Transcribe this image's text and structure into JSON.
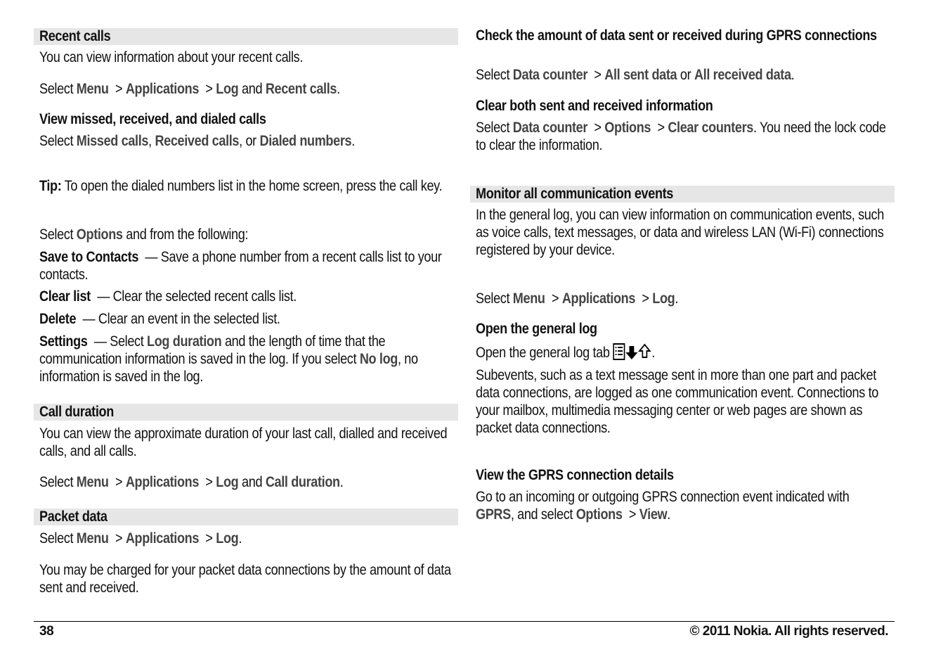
{
  "left": {
    "recent_calls": {
      "heading": "Recent calls",
      "intro": "You can view information about your recent calls.",
      "select_prefix": "Select ",
      "path": [
        "Menu",
        "Applications",
        "Log"
      ],
      "and": " and ",
      "target": "Recent calls",
      "period": "."
    },
    "view_missed": {
      "heading": "View missed, received, and dialed calls",
      "select_prefix": "Select ",
      "opt1": "Missed calls",
      "comma1": ", ",
      "opt2": "Received calls",
      "or": ", or ",
      "opt3": "Dialed numbers",
      "period": "."
    },
    "tip": {
      "label": "Tip:",
      "text": " To open the dialed numbers list in the home screen, press the call key."
    },
    "options": {
      "select_prefix": "Select ",
      "options_label": "Options",
      "suffix": " and from the following:",
      "items": [
        {
          "term": "Save to Contacts",
          "desc": "— Save a phone number from a recent calls list to your contacts."
        },
        {
          "term": "Clear list",
          "desc": "— Clear the selected recent calls list."
        },
        {
          "term": "Delete",
          "desc": "— Clear an event in the selected list."
        },
        {
          "term": "Settings",
          "desc_prefix": "— Select ",
          "ui1": "Log duration",
          "desc_mid": " and the length of time that the communication information is saved in the log. If you select ",
          "ui2": "No log",
          "desc_end": ", no information is saved in the log."
        }
      ]
    },
    "call_duration": {
      "heading": "Call duration",
      "intro": "You can view the approximate duration of your last call, dialled and received calls, and all calls.",
      "select_prefix": "Select ",
      "path": [
        "Menu",
        "Applications",
        "Log"
      ],
      "and": " and ",
      "target": "Call duration",
      "period": "."
    },
    "packet_data": {
      "heading": "Packet data",
      "select_prefix": "Select ",
      "path": [
        "Menu",
        "Applications",
        "Log"
      ],
      "period": ".",
      "note": "You may be charged for your packet data connections by the amount of data sent and received."
    }
  },
  "right": {
    "check_amount": {
      "heading": "Check the amount of data sent or received during GPRS connections",
      "select_prefix": "Select ",
      "ui1": "Data counter",
      "ui2": "All sent data",
      "or": " or ",
      "ui3": "All received data",
      "period": "."
    },
    "clear_both": {
      "heading": "Clear both sent and received information",
      "select_prefix": "Select ",
      "path": [
        "Data counter",
        "Options",
        "Clear counters"
      ],
      "suffix": ". You need the lock code to clear the information."
    },
    "monitor": {
      "heading": "Monitor all communication events",
      "intro": "In the general log, you can view information on communication events, such as voice calls, text messages, or data and wireless LAN (Wi-Fi) connections registered by your device.",
      "select_prefix": "Select ",
      "path": [
        "Menu",
        "Applications",
        "Log"
      ],
      "period": "."
    },
    "open_log": {
      "heading": "Open the general log",
      "text": "Open the general log tab ",
      "icon": "log-list-transfer-icon",
      "period": ".",
      "subevents": "Subevents, such as a text message sent in more than one part and packet data connections, are logged as one communication event. Connections to your mailbox, multimedia messaging center or web pages are shown as packet data connections."
    },
    "gprs_details": {
      "heading": "View the GPRS connection details",
      "text1": "Go to an incoming or outgoing GPRS connection event indicated with ",
      "ui1": "GPRS",
      "text2": ", and select ",
      "ui2": "Options",
      "ui3": "View",
      "period": "."
    }
  },
  "separator": " > ",
  "footer": {
    "page_number": "38",
    "copyright": "© 2011 Nokia. All rights reserved."
  }
}
